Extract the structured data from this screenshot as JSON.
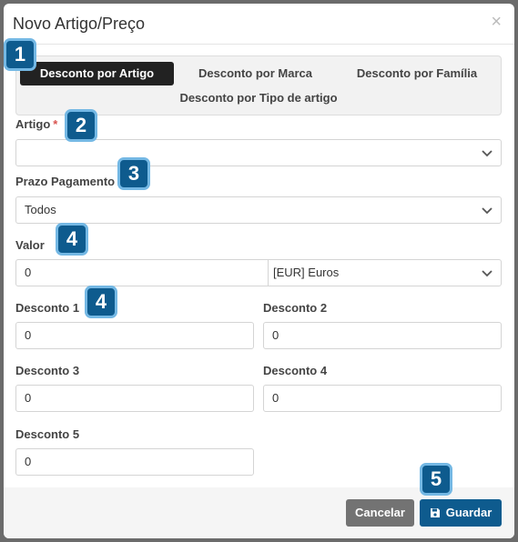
{
  "modal": {
    "title": "Novo Artigo/Preço",
    "close": "×"
  },
  "tabs": [
    {
      "label": "Desconto por Artigo",
      "active": true
    },
    {
      "label": "Desconto por Marca",
      "active": false
    },
    {
      "label": "Desconto por Família",
      "active": false
    },
    {
      "label": "Desconto por Tipo de artigo",
      "active": false
    }
  ],
  "fields": {
    "artigo": {
      "label": "Artigo",
      "required_mark": "*",
      "value": ""
    },
    "prazo": {
      "label": "Prazo Pagamento",
      "value": "Todos"
    },
    "valor": {
      "label": "Valor",
      "value": "0",
      "currency": "[EUR] Euros"
    },
    "desconto1": {
      "label": "Desconto 1",
      "value": "0"
    },
    "desconto2": {
      "label": "Desconto 2",
      "value": "0"
    },
    "desconto3": {
      "label": "Desconto 3",
      "value": "0"
    },
    "desconto4": {
      "label": "Desconto 4",
      "value": "0"
    },
    "desconto5": {
      "label": "Desconto 5",
      "value": "0"
    }
  },
  "badges": [
    "1",
    "2",
    "3",
    "4",
    "4",
    "5"
  ],
  "footer": {
    "cancel_label": "Cancelar",
    "save_label": "Guardar"
  },
  "colors": {
    "primary": "#0e5b8e",
    "badge_border": "#74b8e4",
    "cancel": "#737373",
    "active_tab": "#222222",
    "required": "#d9534f"
  }
}
